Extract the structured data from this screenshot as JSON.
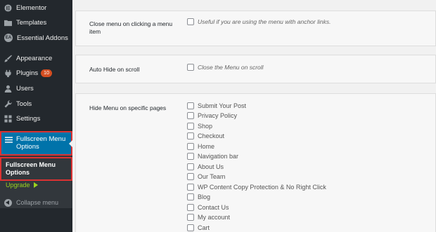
{
  "sidebar": {
    "items": [
      {
        "label": "Elementor",
        "icon": "elementor-icon"
      },
      {
        "label": "Templates",
        "icon": "folder-icon"
      },
      {
        "label": "Essential Addons",
        "icon": "ea-icon",
        "icon_text": "EA"
      },
      {
        "label": "Appearance",
        "icon": "paintbrush-icon"
      },
      {
        "label": "Plugins",
        "icon": "plugin-icon",
        "badge": "10"
      },
      {
        "label": "Users",
        "icon": "users-icon"
      },
      {
        "label": "Tools",
        "icon": "wrench-icon"
      },
      {
        "label": "Settings",
        "icon": "settings-icon"
      }
    ],
    "current": {
      "label_line1": "Fullscreen Menu",
      "label_line2": "Options",
      "icon": "menu-icon"
    },
    "submenu": {
      "current_line1": "Fullscreen Menu",
      "current_line2": "Options",
      "upgrade": "Upgrade"
    },
    "collapse": "Collapse menu"
  },
  "settings": {
    "close_menu": {
      "label_line1": "Close menu on clicking a menu",
      "label_line2": "item",
      "description": "Useful if you are using the menu with anchor links."
    },
    "auto_hide": {
      "label": "Auto Hide on scroll",
      "description": "Close the Menu on scroll"
    },
    "hide_menu": {
      "label": "Hide Menu on specific pages",
      "pages": [
        "Submit Your Post",
        "Privacy Policy",
        "Shop",
        "Checkout",
        "Home",
        "Navigation bar",
        "About Us",
        "Our Team",
        "WP Content Copy Protection & No Right Click",
        "Blog",
        "Contact Us",
        "My account",
        "Cart"
      ]
    }
  },
  "colors": {
    "sidebar_bg": "#23282d",
    "accent": "#0073aa",
    "highlight_border": "#dc3232",
    "upgrade": "#9cd21f",
    "badge": "#d54e21"
  }
}
